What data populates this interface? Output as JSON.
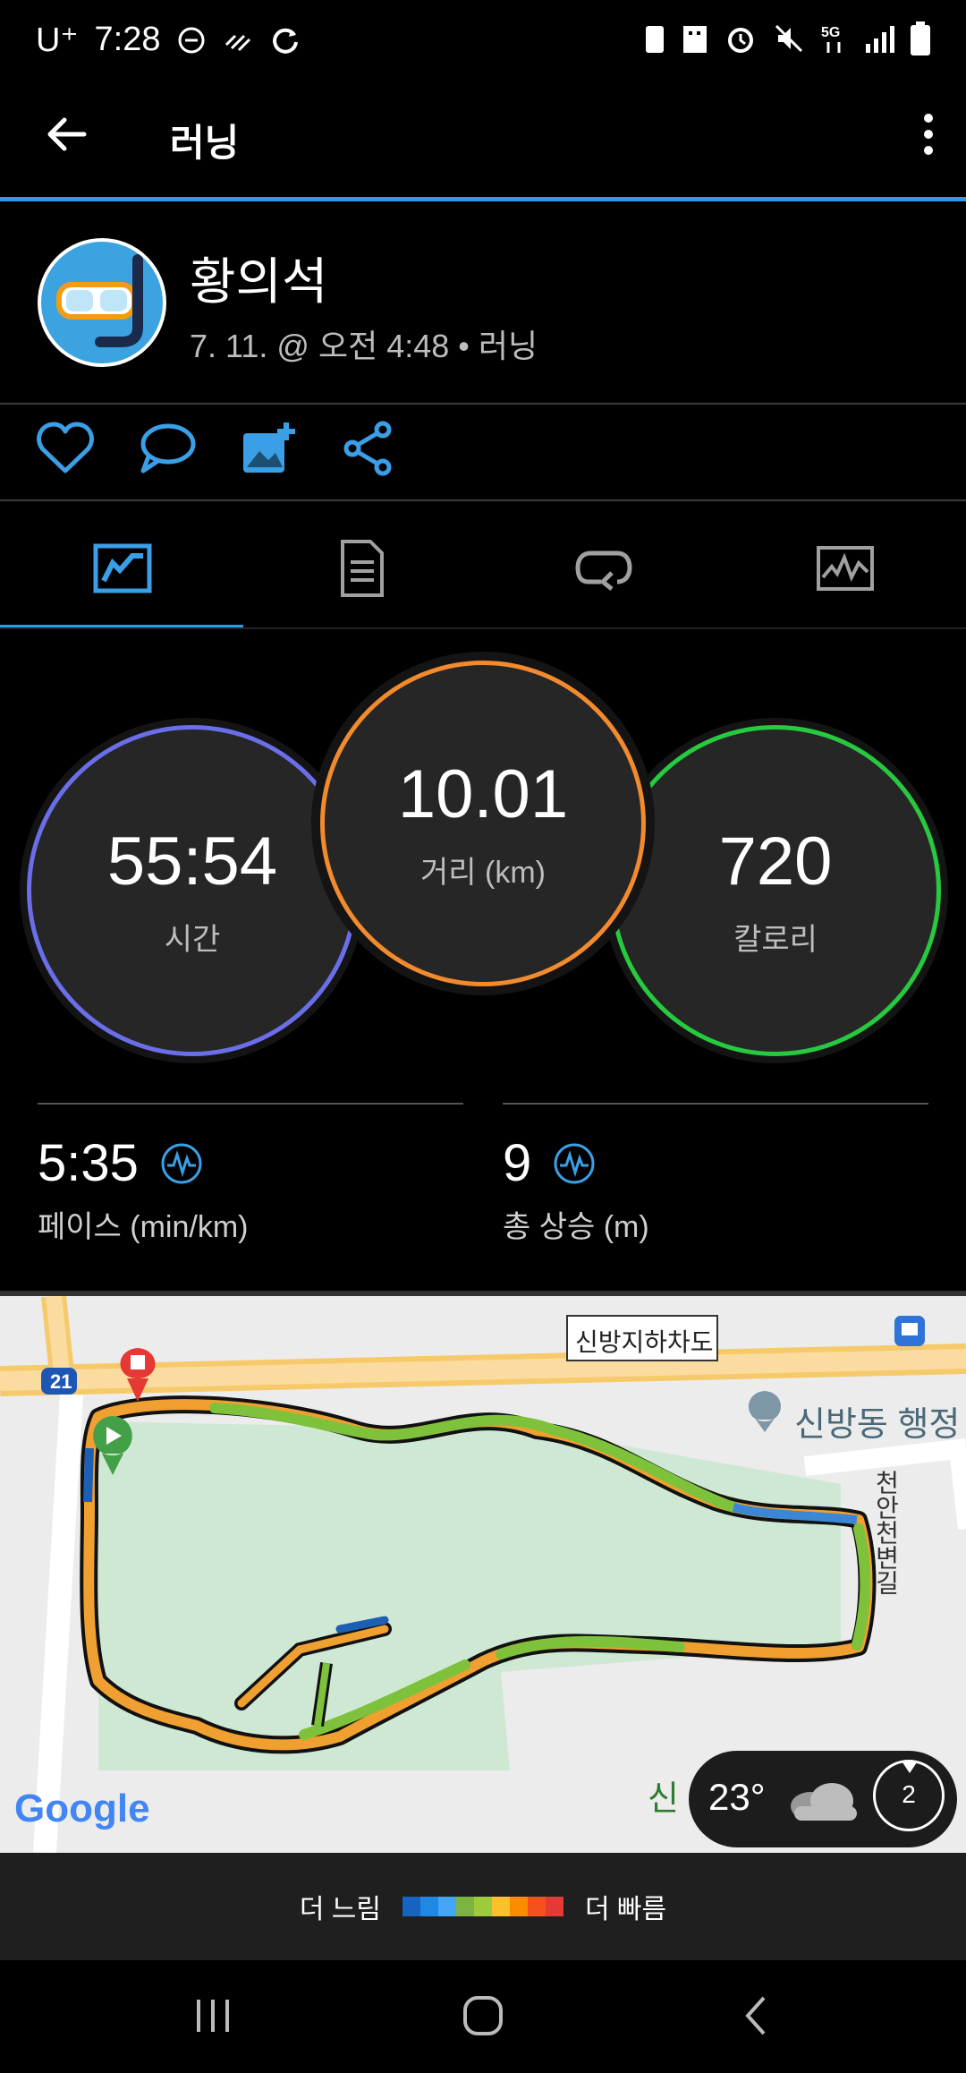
{
  "status_bar": {
    "carrier": "U⁺",
    "time": "7:28"
  },
  "app_bar": {
    "title": "러닝"
  },
  "activity": {
    "user_name": "황의석",
    "meta": "7. 11. @ 오전 4:48 • 러닝"
  },
  "tabs": [
    "overview-chart-icon",
    "document-icon",
    "laps-icon",
    "graph-icon"
  ],
  "summary": {
    "time": {
      "value": "55:54",
      "label": "시간"
    },
    "distance": {
      "value": "10.01",
      "label": "거리 (km)"
    },
    "calories": {
      "value": "720",
      "label": "칼로리"
    }
  },
  "stats": {
    "pace": {
      "value": "5:35",
      "label": "페이스 (min/km)"
    },
    "ascent": {
      "value": "9",
      "label": "총 상승 (m)"
    }
  },
  "map": {
    "road_label": "신방지하차도",
    "place_label": "신방동 행정",
    "street_label": "천안천변길",
    "route_number": "21",
    "partial_label": "신",
    "weather": {
      "temp": "23°",
      "badge": "2"
    },
    "google": "Google"
  },
  "legend": {
    "slower": "더 느림",
    "faster": "더 빠름",
    "colors": [
      "#1565c0",
      "#1e88e5",
      "#42a5f5",
      "#7cb342",
      "#9ccc3b",
      "#fbc02d",
      "#fb8c00",
      "#f4511e",
      "#e53935"
    ]
  },
  "colors": {
    "accent": "#2f9be8",
    "time_ring": "#6a6ee8",
    "distance_ring": "#f28a2e",
    "calories_ring": "#27c93f"
  }
}
